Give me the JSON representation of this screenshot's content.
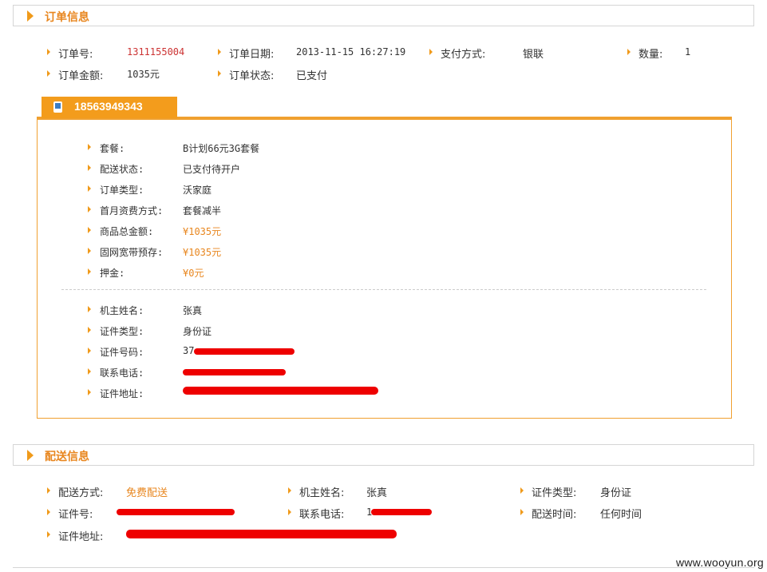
{
  "order_section": {
    "title": "订单信息",
    "fields": [
      {
        "label": "订单号:",
        "value": "1311155004"
      },
      {
        "label": "订单日期:",
        "value": "2013-11-15 16:27:19"
      },
      {
        "label": "支付方式:",
        "value": "银联"
      },
      {
        "label": "数量:",
        "value": "1"
      },
      {
        "label": "订单金额:",
        "value": "1035元"
      },
      {
        "label": "订单状态:",
        "value": "已支付"
      }
    ]
  },
  "phone_panel": {
    "number": "18563949343",
    "details": [
      {
        "label": "套餐:",
        "value": "B计划66元3G套餐"
      },
      {
        "label": "配送状态:",
        "value": "已支付待开户"
      },
      {
        "label": "订单类型:",
        "value": "沃家庭"
      },
      {
        "label": "首月资费方式:",
        "value": "套餐减半"
      },
      {
        "label": "商品总金额:",
        "value": "¥1035元"
      },
      {
        "label": "固网宽带预存:",
        "value": "¥1035元"
      },
      {
        "label": "押金:",
        "value": "¥0元"
      }
    ],
    "owner": [
      {
        "label": "机主姓名:",
        "value": "张真"
      },
      {
        "label": "证件类型:",
        "value": "身份证"
      },
      {
        "label": "证件号码:",
        "value": "37"
      },
      {
        "label": "联系电话:",
        "value": ""
      },
      {
        "label": "证件地址:",
        "value": ""
      }
    ]
  },
  "delivery_section": {
    "title": "配送信息",
    "fields": [
      {
        "label": "配送方式:",
        "value": "免费配送"
      },
      {
        "label": "机主姓名:",
        "value": "张真"
      },
      {
        "label": "证件类型:",
        "value": "身份证"
      },
      {
        "label": "证件号:",
        "value": ""
      },
      {
        "label": "联系电话:",
        "value": "1"
      },
      {
        "label": "配送时间:",
        "value": "任何时间"
      },
      {
        "label": "证件地址:",
        "value": ""
      }
    ]
  },
  "watermark": "www.wooyun.org",
  "colors": {
    "accent": "#f09a1a",
    "title": "#e8861e",
    "value_red": "#cc3333",
    "redaction": "#ee0000"
  }
}
